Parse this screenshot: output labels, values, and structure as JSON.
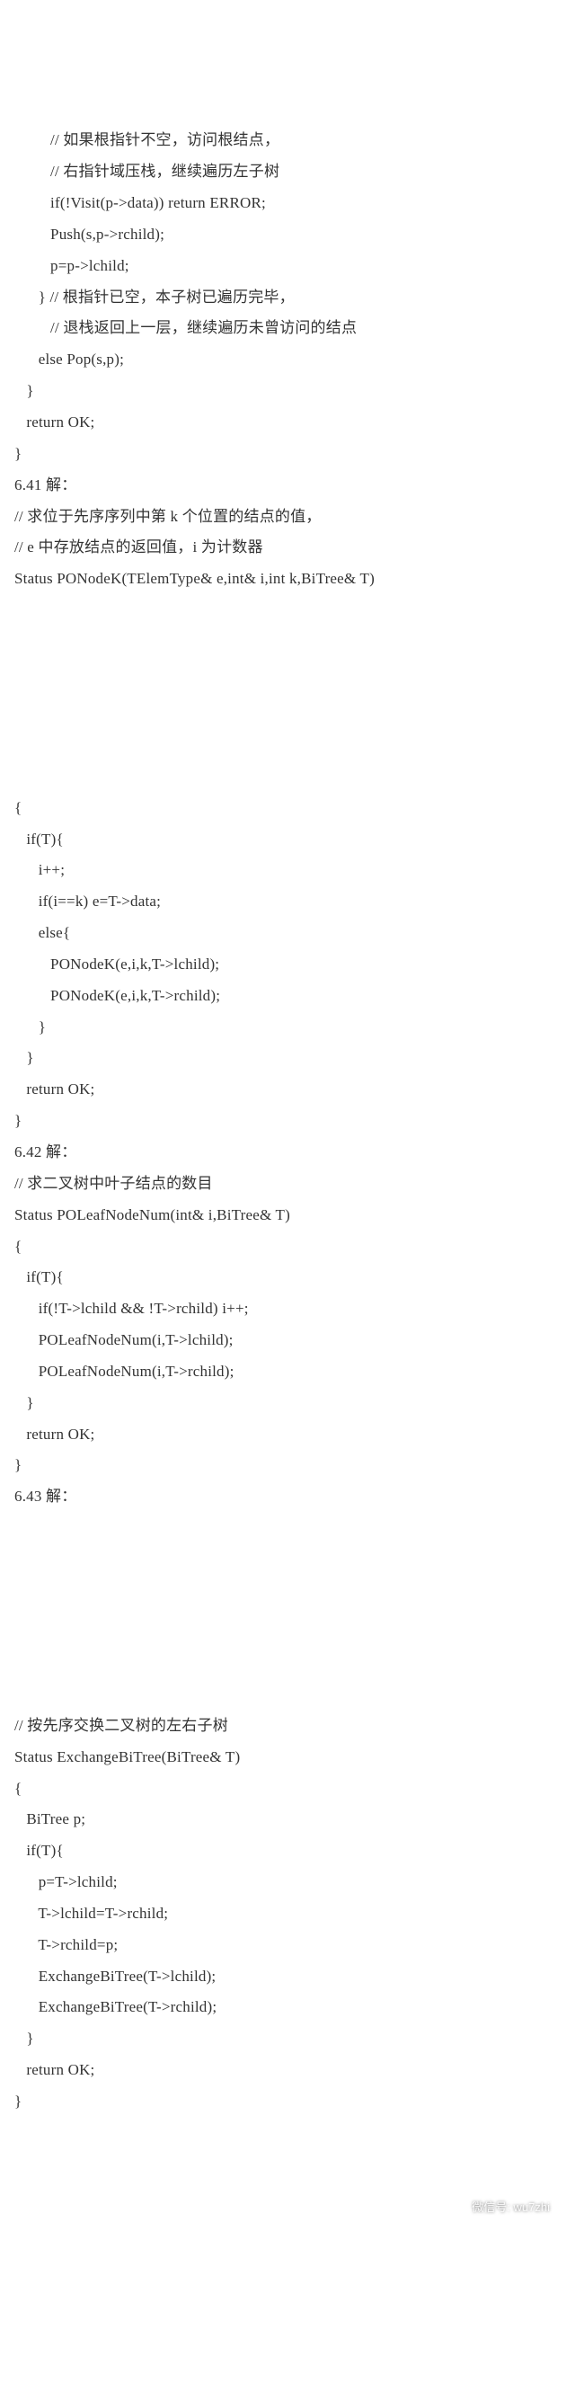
{
  "footer": {
    "label": "微信号: wu7zhi"
  },
  "block1": [
    "         // 如果根指针不空，访问根结点，",
    "         // 右指针域压栈，继续遍历左子树",
    "         if(!Visit(p->data)) return ERROR;",
    "         Push(s,p->rchild);",
    "         p=p->lchild;",
    "      } // 根指针已空，本子树已遍历完毕，",
    "         // 退栈返回上一层，继续遍历未曾访问的结点",
    "      else Pop(s,p);",
    "   }",
    "   return OK;",
    "}",
    "6.41 解：",
    "// 求位于先序序列中第 k 个位置的结点的值，",
    "// e 中存放结点的返回值，i 为计数器",
    "Status PONodeK(TElemType& e,int& i,int k,BiTree& T)"
  ],
  "block2": [
    "{",
    "   if(T){",
    "      i++;",
    "      if(i==k) e=T->data;",
    "      else{",
    "         PONodeK(e,i,k,T->lchild);",
    "         PONodeK(e,i,k,T->rchild);",
    "      }",
    "   }",
    "   return OK;",
    "}",
    "6.42 解：",
    "// 求二叉树中叶子结点的数目",
    "Status POLeafNodeNum(int& i,BiTree& T)",
    "{",
    "   if(T){",
    "      if(!T->lchild && !T->rchild) i++;",
    "      POLeafNodeNum(i,T->lchild);",
    "      POLeafNodeNum(i,T->rchild);",
    "   }",
    "   return OK;",
    "}",
    "6.43 解："
  ],
  "block3": [
    "// 按先序交换二叉树的左右子树",
    "Status ExchangeBiTree(BiTree& T)",
    "{",
    "   BiTree p;",
    "   if(T){",
    "      p=T->lchild;",
    "      T->lchild=T->rchild;",
    "      T->rchild=p;",
    "      ExchangeBiTree(T->lchild);",
    "      ExchangeBiTree(T->rchild);",
    "   }",
    "   return OK;",
    "}"
  ]
}
